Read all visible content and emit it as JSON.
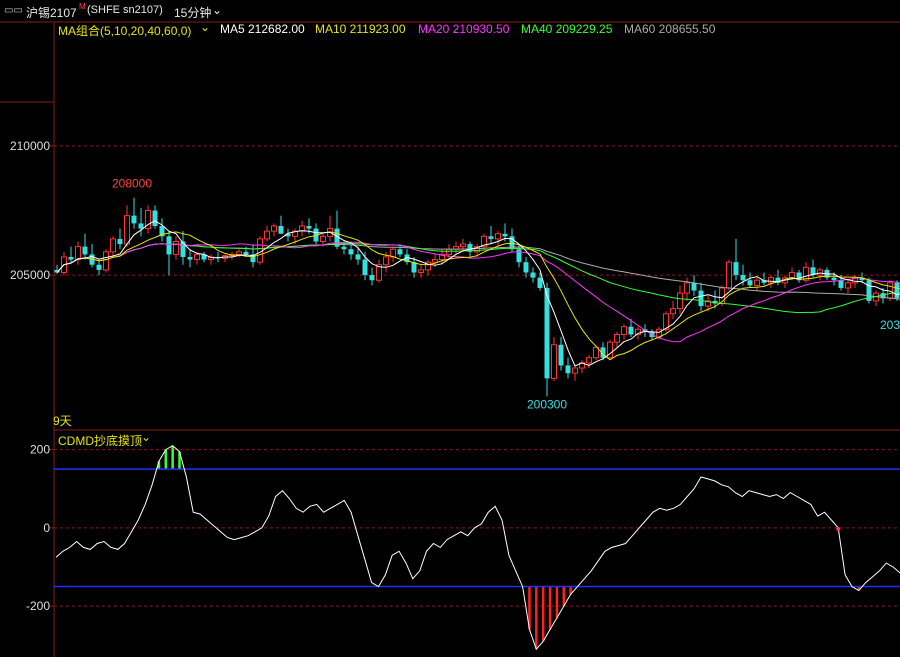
{
  "header": {
    "symbol": "沪锡2107",
    "superscript": "M",
    "exchange": "(SHFE sn2107)",
    "period": "15分钟",
    "menu_icon": "chevron-down-icon",
    "window_icon": "window-restore-icon"
  },
  "ma_legend": {
    "group": "MA组合(5,10,20,40,60,0)",
    "ma5": "MA5 212682.00",
    "ma10": "MA10 211923.00",
    "ma20": "MA20 210930.50",
    "ma40": "MA40 209229.25",
    "ma60": "MA60 208655.50"
  },
  "indicator_legend": {
    "name": "CDMD抄底摸顶"
  },
  "colors": {
    "up": "#ff3333",
    "down": "#33e0e0",
    "grid": "#8b1a1a",
    "ma5": "#ffffff",
    "ma10": "#e6e600",
    "ma20": "#ff33ff",
    "ma40": "#33ff33",
    "ma60": "#aaaaaa",
    "cdmd": "#ffffff",
    "band": "#2030ff"
  },
  "chart_data": [
    {
      "type": "candlestick",
      "title": "沪锡2107 15分钟",
      "y_ticks": [
        "210000",
        "205000"
      ],
      "ylim": [
        199000,
        214800
      ],
      "annotations": {
        "high": "208000",
        "low": "200300",
        "right_edge": "203",
        "time_marker": "9天"
      },
      "candles": [
        [
          205200,
          205400,
          205050,
          205100
        ],
        [
          205100,
          205900,
          205000,
          205700
        ],
        [
          205700,
          206100,
          205500,
          205600
        ],
        [
          205600,
          206300,
          205400,
          206100
        ],
        [
          206100,
          206600,
          205600,
          205800
        ],
        [
          205800,
          206200,
          205300,
          205400
        ],
        [
          205400,
          205600,
          205000,
          205200
        ],
        [
          205200,
          206000,
          205100,
          205900
        ],
        [
          205900,
          206500,
          205700,
          206400
        ],
        [
          206400,
          206800,
          206000,
          206200
        ],
        [
          206200,
          207700,
          206100,
          207300
        ],
        [
          207300,
          208000,
          206800,
          207000
        ],
        [
          207000,
          207600,
          206500,
          206800
        ],
        [
          206800,
          207700,
          206600,
          207500
        ],
        [
          207500,
          207700,
          206800,
          206900
        ],
        [
          206900,
          207200,
          206300,
          206500
        ],
        [
          206500,
          206700,
          205000,
          205800
        ],
        [
          205800,
          206500,
          205600,
          206300
        ],
        [
          206300,
          206700,
          205400,
          205700
        ],
        [
          205700,
          206000,
          205300,
          205600
        ],
        [
          205600,
          205900,
          205400,
          205800
        ],
        [
          205800,
          205900,
          205500,
          205600
        ],
        [
          205600,
          205800,
          205400,
          205700
        ],
        [
          205700,
          205900,
          205500,
          205650
        ],
        [
          205650,
          205800,
          205500,
          205750
        ],
        [
          205750,
          205900,
          205600,
          205800
        ],
        [
          205800,
          206000,
          205700,
          205900
        ],
        [
          205900,
          206100,
          205700,
          205800
        ],
        [
          205800,
          206200,
          205300,
          205500
        ],
        [
          205500,
          206500,
          205400,
          206400
        ],
        [
          206400,
          206900,
          206300,
          206700
        ],
        [
          206700,
          207000,
          206500,
          206900
        ],
        [
          206900,
          207300,
          206700,
          206600
        ],
        [
          206600,
          206800,
          206300,
          206500
        ],
        [
          206500,
          206800,
          206200,
          206700
        ],
        [
          206700,
          207100,
          206500,
          206900
        ],
        [
          206900,
          207200,
          206600,
          206800
        ],
        [
          206800,
          207000,
          206200,
          206300
        ],
        [
          206300,
          206600,
          206100,
          206500
        ],
        [
          206500,
          207300,
          206300,
          206800
        ],
        [
          206800,
          207500,
          206000,
          206100
        ],
        [
          206100,
          206300,
          205800,
          206000
        ],
        [
          206000,
          206300,
          205600,
          205800
        ],
        [
          205800,
          206100,
          205400,
          205600
        ],
        [
          205600,
          205900,
          204800,
          205000
        ],
        [
          205000,
          205300,
          204600,
          204800
        ],
        [
          204800,
          205600,
          204700,
          205400
        ],
        [
          205400,
          205900,
          205100,
          205700
        ],
        [
          205700,
          206100,
          205500,
          206000
        ],
        [
          206000,
          206200,
          205700,
          205800
        ],
        [
          205800,
          206000,
          205400,
          205500
        ],
        [
          205500,
          205700,
          204900,
          205100
        ],
        [
          205100,
          205400,
          204900,
          205200
        ],
        [
          205200,
          205600,
          205000,
          205500
        ],
        [
          205500,
          205800,
          205300,
          205600
        ],
        [
          205600,
          206000,
          205400,
          205800
        ],
        [
          205800,
          206200,
          205600,
          206000
        ],
        [
          206000,
          206300,
          205800,
          206100
        ],
        [
          206100,
          206400,
          205900,
          206200
        ],
        [
          206200,
          206300,
          205700,
          205900
        ],
        [
          205900,
          206200,
          205700,
          206100
        ],
        [
          206100,
          206600,
          206000,
          206500
        ],
        [
          206500,
          206900,
          206200,
          206400
        ],
        [
          206400,
          206700,
          206100,
          206600
        ],
        [
          206600,
          207000,
          206300,
          206500
        ],
        [
          206500,
          206800,
          205900,
          206000
        ],
        [
          206000,
          206200,
          205300,
          205500
        ],
        [
          205500,
          205700,
          204900,
          205100
        ],
        [
          205100,
          205300,
          204700,
          204900
        ],
        [
          204900,
          205100,
          204400,
          204500
        ],
        [
          204500,
          204700,
          200300,
          201000
        ],
        [
          201000,
          202600,
          200900,
          202300
        ],
        [
          202300,
          202600,
          201300,
          201500
        ],
        [
          201500,
          201800,
          201000,
          201200
        ],
        [
          201200,
          201500,
          200900,
          201400
        ],
        [
          201400,
          201700,
          201200,
          201600
        ],
        [
          201600,
          201900,
          201400,
          201800
        ],
        [
          201800,
          202300,
          201700,
          202200
        ],
        [
          202200,
          202400,
          201700,
          201800
        ],
        [
          201800,
          202500,
          201700,
          202400
        ],
        [
          202400,
          202800,
          202200,
          202700
        ],
        [
          202700,
          203100,
          202500,
          203000
        ],
        [
          203000,
          203300,
          202600,
          202700
        ],
        [
          202700,
          203000,
          202500,
          202900
        ],
        [
          202900,
          203100,
          202600,
          202800
        ],
        [
          202800,
          202900,
          202500,
          202600
        ],
        [
          202600,
          203000,
          202500,
          202900
        ],
        [
          202900,
          203600,
          202800,
          203500
        ],
        [
          203500,
          204000,
          203300,
          203700
        ],
        [
          203700,
          204600,
          203500,
          204300
        ],
        [
          204300,
          204900,
          204000,
          204700
        ],
        [
          204700,
          205000,
          204200,
          204400
        ],
        [
          204400,
          204700,
          203600,
          203800
        ],
        [
          203800,
          204200,
          203600,
          204000
        ],
        [
          204000,
          204400,
          203700,
          203900
        ],
        [
          203900,
          204600,
          203800,
          204500
        ],
        [
          204500,
          205600,
          204400,
          205500
        ],
        [
          205500,
          206400,
          204800,
          205000
        ],
        [
          205000,
          205400,
          204600,
          204800
        ],
        [
          204800,
          205100,
          204500,
          204600
        ],
        [
          204600,
          204900,
          204400,
          204800
        ],
        [
          204800,
          205100,
          204600,
          204700
        ],
        [
          204700,
          205000,
          204500,
          204900
        ],
        [
          204900,
          205200,
          204600,
          204700
        ],
        [
          204700,
          205000,
          204500,
          204900
        ],
        [
          204900,
          205300,
          204800,
          205100
        ],
        [
          205100,
          205200,
          204700,
          204800
        ],
        [
          204800,
          205500,
          204700,
          205300
        ],
        [
          205300,
          205600,
          204900,
          205000
        ],
        [
          205000,
          205300,
          204800,
          205200
        ],
        [
          205200,
          205300,
          204800,
          204900
        ],
        [
          204900,
          205100,
          204600,
          204800
        ],
        [
          204800,
          205000,
          204400,
          204500
        ],
        [
          204500,
          204800,
          204300,
          204700
        ],
        [
          204700,
          205000,
          204500,
          204900
        ],
        [
          204900,
          205100,
          204700,
          204800
        ],
        [
          204800,
          204900,
          203900,
          204000
        ],
        [
          204000,
          204400,
          203800,
          204300
        ],
        [
          204300,
          204500,
          203900,
          204100
        ],
        [
          204100,
          204800,
          204000,
          204700
        ],
        [
          204700,
          204800,
          204000,
          204100
        ],
        [
          204100,
          204400,
          204000,
          204300
        ],
        [
          204300,
          204600,
          204100,
          204200
        ],
        [
          204200,
          204300,
          203900,
          204000
        ]
      ]
    },
    {
      "type": "line",
      "title": "CDMD抄底摸顶",
      "y_ticks": [
        "200",
        "0",
        "-200"
      ],
      "ylim": [
        -330,
        250
      ],
      "thresholds": [
        150,
        -150
      ],
      "values": [
        -75,
        -60,
        -50,
        -35,
        -50,
        -55,
        -40,
        -35,
        -50,
        -55,
        -40,
        -10,
        20,
        60,
        110,
        170,
        200,
        210,
        195,
        130,
        40,
        35,
        20,
        5,
        -10,
        -25,
        -30,
        -25,
        -20,
        -10,
        0,
        30,
        80,
        95,
        75,
        50,
        40,
        55,
        60,
        40,
        50,
        60,
        70,
        40,
        -20,
        -80,
        -140,
        -150,
        -120,
        -70,
        -60,
        -90,
        -130,
        -110,
        -60,
        -40,
        -50,
        -30,
        -20,
        -10,
        -20,
        0,
        10,
        40,
        55,
        20,
        -70,
        -110,
        -150,
        -260,
        -310,
        -290,
        -260,
        -230,
        -200,
        -170,
        -150,
        -130,
        -110,
        -85,
        -60,
        -50,
        -45,
        -40,
        -20,
        0,
        20,
        40,
        50,
        45,
        50,
        60,
        80,
        100,
        130,
        125,
        120,
        110,
        105,
        90,
        80,
        95,
        90,
        85,
        80,
        85,
        75,
        90,
        80,
        70,
        60,
        30,
        40,
        20,
        0,
        -120,
        -150,
        -160,
        -140,
        -125,
        -110,
        -90,
        -100,
        -115
      ]
    }
  ]
}
